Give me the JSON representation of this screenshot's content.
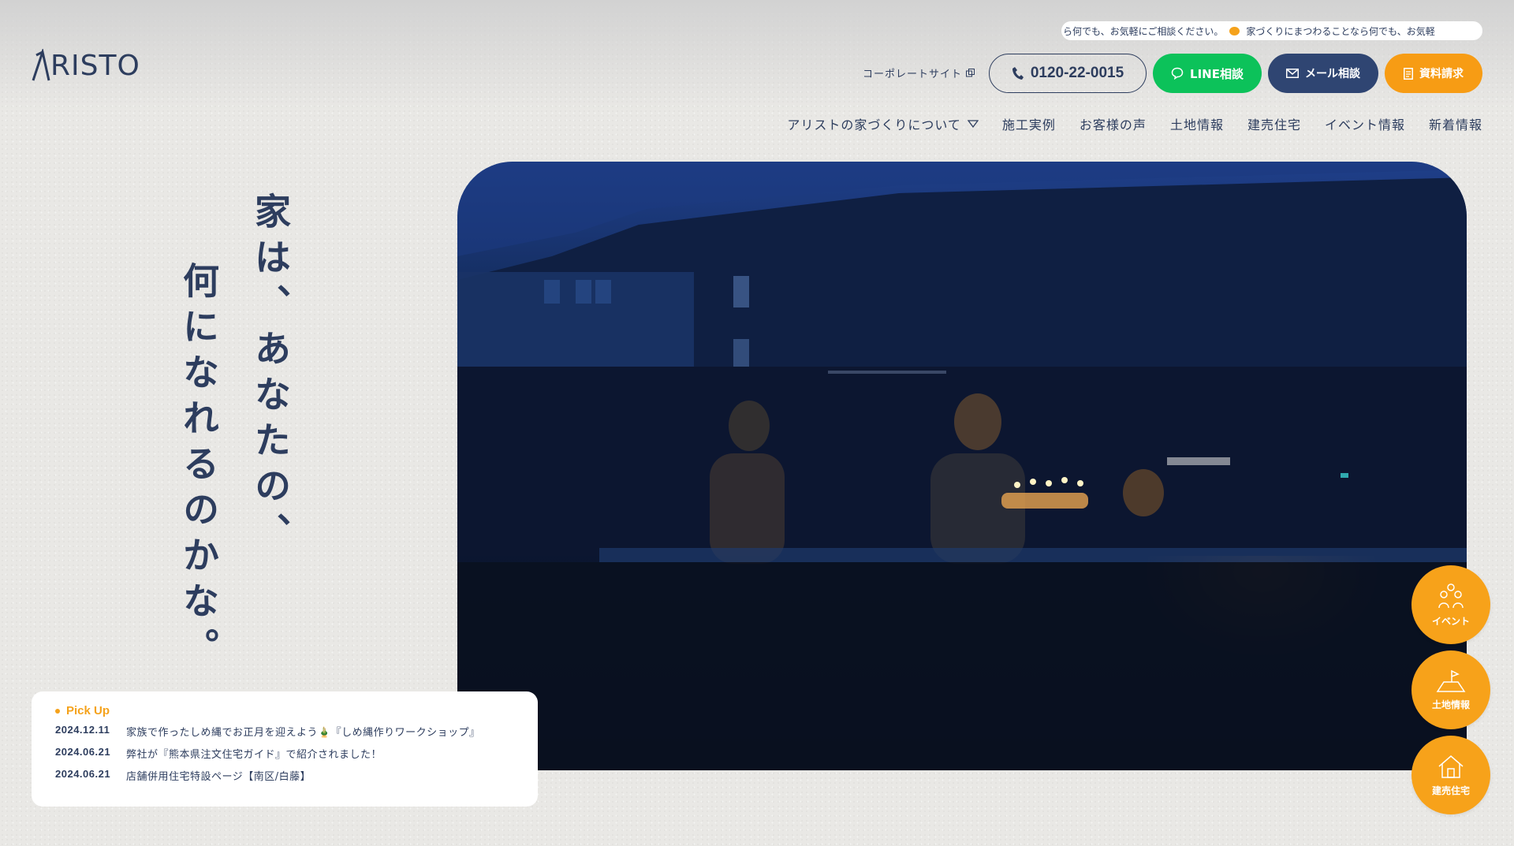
{
  "ticker": {
    "text_a": "ら何でも、お気軽にご相談ください。",
    "text_b": "家づくりにまつわることなら何でも、お気軽"
  },
  "logo": {
    "text": "RISTO"
  },
  "header": {
    "corporate_label": "コーポレートサイト",
    "tel_label": "0120-22-0015",
    "line_label": "LINE相談",
    "mail_label": "メール相談",
    "doc_label": "資料請求"
  },
  "nav": {
    "items": [
      "アリストの家づくりについて",
      "施工実例",
      "お客様の声",
      "土地情報",
      "建売住宅",
      "イベント情報",
      "新着情報"
    ]
  },
  "tagline": {
    "col1": "家は、あなたの、",
    "col2": "何になれるのかな。"
  },
  "pickup": {
    "title": "Pick Up",
    "news": [
      {
        "date": "2024.12.11",
        "text": "家族で作ったしめ縄でお正月を迎えよう🎍『しめ縄作りワークショップ』"
      },
      {
        "date": "2024.06.21",
        "text": "弊社が『熊本県注文住宅ガイド』で紹介されました！"
      },
      {
        "date": "2024.06.21",
        "text": "店舗併用住宅特設ページ【南区/白藤】"
      }
    ]
  },
  "fabs": {
    "event": "イベント",
    "land": "土地情報",
    "house": "建売住宅"
  },
  "colors": {
    "navy": "#2d3d5e",
    "orange": "#f79c14",
    "line_green": "#0cc25a",
    "mail_navy": "#2f4572"
  }
}
